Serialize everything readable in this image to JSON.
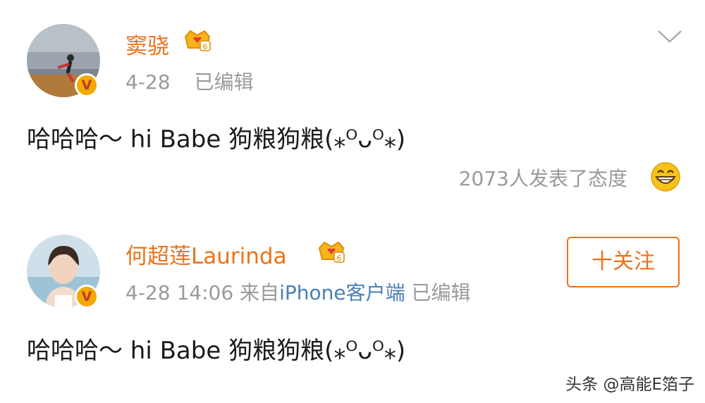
{
  "posts": [
    {
      "author": "窦骁",
      "date": "4-28",
      "edited": "已编辑",
      "content": "哈哈哈～ hi Babe 狗粮狗粮(⁎ᴼᴗᴼ⁎)",
      "reactions": "2073人发表了态度",
      "icons": [
        "verified-icon",
        "crown-badge-icon",
        "chevron-down-icon",
        "grin-emoji-icon"
      ]
    },
    {
      "author": "何超莲Laurinda",
      "datetime": "4-28 14:06",
      "source_prefix": "来自",
      "source": "iPhone客户端",
      "edited": "已编辑",
      "follow_label": "十关注",
      "content": "哈哈哈～ hi Babe 狗粮狗粮(⁎ᴼᴗᴼ⁎)",
      "icons": [
        "verified-icon",
        "crown-badge-icon"
      ]
    }
  ],
  "watermark": "头条 @高能E箔子",
  "verified_mark": "V",
  "colors": {
    "name": "#e9731b",
    "meta": "#9a9a9a",
    "link": "#4a7fb8",
    "verified": "#f2a900"
  }
}
